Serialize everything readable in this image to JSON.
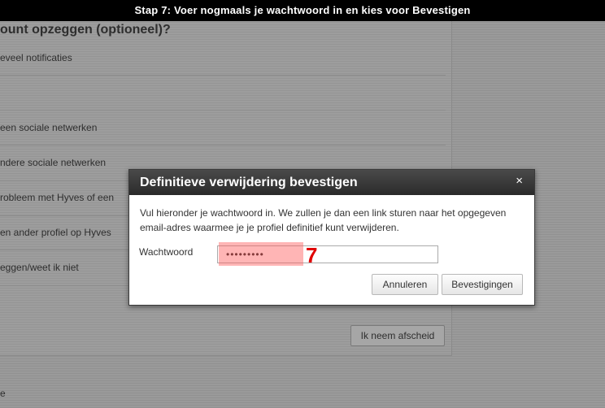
{
  "banner": {
    "text": "Stap 7: Voer nogmaals je wachtwoord in en kies voor Bevestigen"
  },
  "background": {
    "title": "ount opzeggen (optioneel)?",
    "options": [
      "eveel notificaties",
      "een sociale netwerken",
      "ndere sociale netwerken",
      "robleem met Hyves of een",
      "en ander profiel op Hyves",
      "eggen/weet ik niet"
    ],
    "goodbye_button": "Ik neem afscheid",
    "bottom_text": "e"
  },
  "dialog": {
    "title": "Definitieve verwijdering bevestigen",
    "close_symbol": "×",
    "description": "Vul hieronder je wachtwoord in. We zullen je dan een link sturen naar het opgegeven email-adres waarmee je je profiel definitief kunt verwijderen.",
    "password_label": "Wachtwoord",
    "password_value": "•••••••••",
    "step_marker": "7",
    "cancel_label": "Annuleren",
    "confirm_label": "Bevestigingen"
  },
  "colors": {
    "marker": "#e00000",
    "header": "#333333"
  }
}
